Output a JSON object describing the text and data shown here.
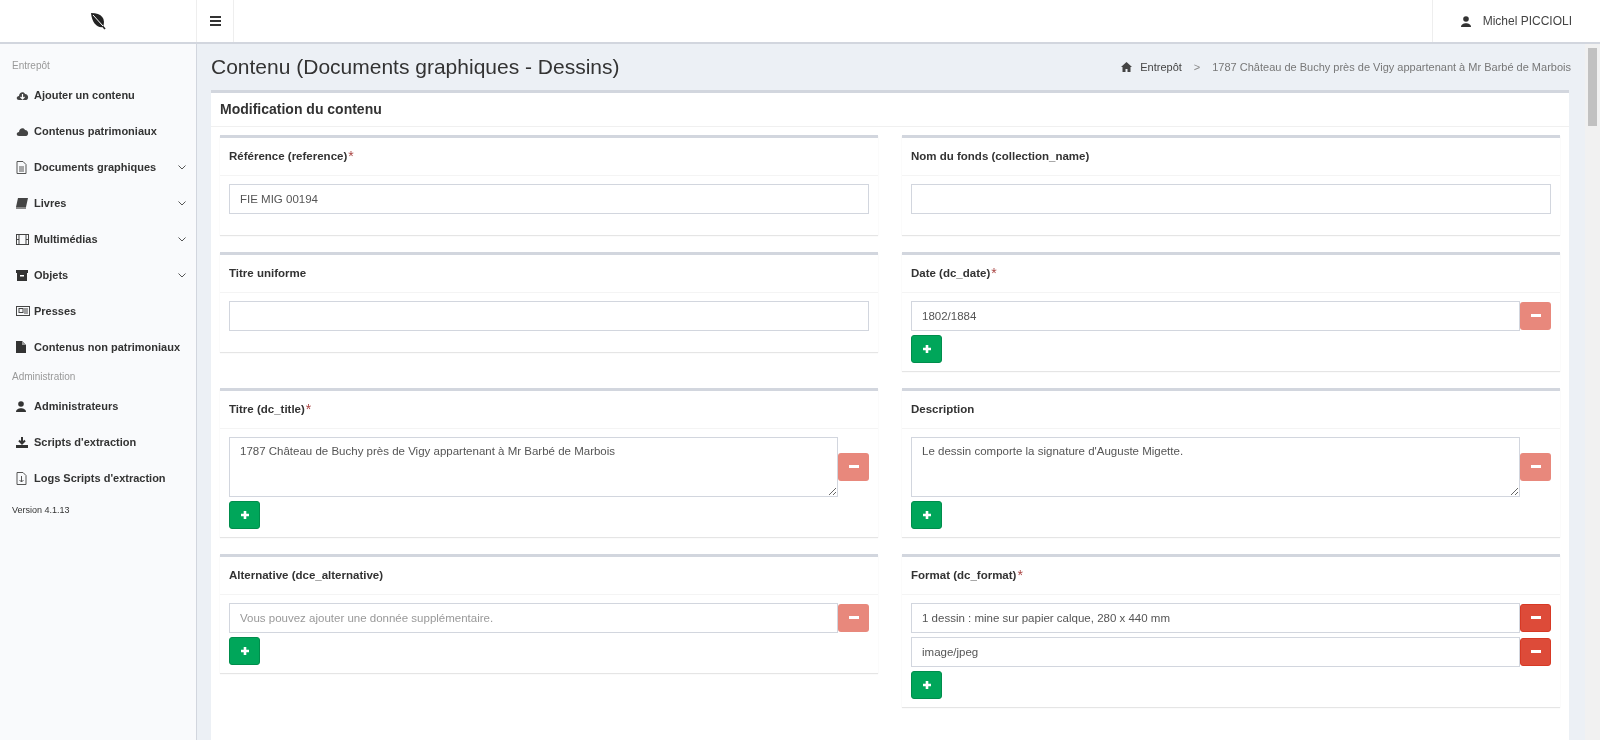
{
  "topbar": {
    "user": "Michel PICCIOLI"
  },
  "sidebar": {
    "sections": [
      {
        "heading": "Entrepôt",
        "items": [
          {
            "label": "Ajouter un contenu",
            "expandable": false
          },
          {
            "label": "Contenus patrimoniaux",
            "expandable": false
          },
          {
            "label": "Documents graphiques",
            "expandable": true
          },
          {
            "label": "Livres",
            "expandable": true
          },
          {
            "label": "Multimédias",
            "expandable": true
          },
          {
            "label": "Objets",
            "expandable": true
          },
          {
            "label": "Presses",
            "expandable": false
          },
          {
            "label": "Contenus non patrimoniaux",
            "expandable": false
          }
        ]
      },
      {
        "heading": "Administration",
        "items": [
          {
            "label": "Administrateurs",
            "expandable": false
          },
          {
            "label": "Scripts d'extraction",
            "expandable": false
          },
          {
            "label": "Logs Scripts d'extraction",
            "expandable": false
          }
        ]
      }
    ],
    "version": "Version 4.1.13"
  },
  "page": {
    "title": "Contenu (Documents graphiques - Dessins)",
    "breadcrumb": {
      "home": "Entrepôt",
      "separator": ">",
      "current": "1787 Château de Buchy près de Vigy appartenant à Mr Barbé de Marbois"
    }
  },
  "form": {
    "title": "Modification du contenu",
    "fields": [
      {
        "label": "Référence (reference)",
        "required_mark": "*",
        "kind": "input",
        "multiple": false,
        "values": [
          {
            "value": "FIE MIG 00194"
          }
        ]
      },
      {
        "label": "Nom du fonds (collection_name)",
        "kind": "input",
        "multiple": false
      },
      {
        "label": "Titre uniforme",
        "kind": "input",
        "multiple": false
      },
      {
        "label": "Date (dc_date)",
        "required_mark": "*",
        "kind": "input",
        "multiple": true,
        "values": [
          {
            "value": "1802/1884",
            "remove_disabled": true
          }
        ]
      },
      {
        "label": "Titre (dc_title)",
        "required_mark": "*",
        "kind": "textarea",
        "multiple": true,
        "values": [
          {
            "value": "1787 Château de Buchy près de Vigy appartenant à Mr Barbé de Marbois",
            "remove_disabled": true
          }
        ]
      },
      {
        "label": "Description",
        "kind": "textarea",
        "multiple": true,
        "values": [
          {
            "value": "Le dessin comporte la signature d'Auguste Migette.",
            "remove_disabled": true
          }
        ]
      },
      {
        "label": "Alternative (dce_alternative)",
        "kind": "input",
        "multiple": true,
        "values": [
          {
            "placeholder": "Vous pouvez ajouter une donnée supplémentaire.",
            "remove_disabled": true
          }
        ]
      },
      {
        "label": "Format (dc_format)",
        "required_mark": "*",
        "kind": "input",
        "multiple": true,
        "values": [
          {
            "value": "1 dessin : mine sur papier calque, 280 x 440 mm",
            "remove_disabled": false
          },
          {
            "value": "image/jpeg",
            "remove_disabled": false
          }
        ]
      }
    ]
  }
}
